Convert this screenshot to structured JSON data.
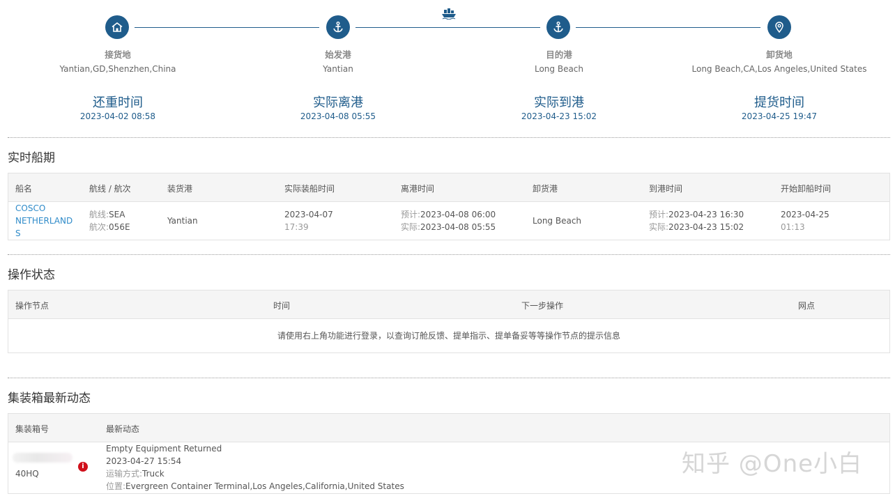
{
  "route": {
    "stops": [
      {
        "name": "接货地",
        "place": "Yantian,GD,Shenzhen,China",
        "event": "还重时间",
        "time": "2023-04-02 08:58",
        "icon": "home-icon"
      },
      {
        "name": "始发港",
        "place": "Yantian",
        "event": "实际离港",
        "time": "2023-04-08 05:55",
        "icon": "anchor-icon"
      },
      {
        "name": "目的港",
        "place": "Long Beach",
        "event": "实际到港",
        "time": "2023-04-23 15:02",
        "icon": "anchor-icon"
      },
      {
        "name": "卸货地",
        "place": "Long Beach,CA,Los Angeles,United States",
        "event": "提货时间",
        "time": "2023-04-25 19:47",
        "icon": "location-pin-icon"
      }
    ],
    "ship_icon": "ship-icon",
    "accent_color": "#1f5c8b"
  },
  "schedule": {
    "title": "实时船期",
    "headers": [
      "船名",
      "航线 / 航次",
      "装货港",
      "实际装船时间",
      "离港时间",
      "卸货港",
      "到港时间",
      "开始卸船时间"
    ],
    "row": {
      "vessel_line1": "COSCO",
      "vessel_line2": "NETHERLAND",
      "vessel_line3": "S",
      "route_label": "航线:",
      "route_value": "SEA",
      "voyage_label": "航次:",
      "voyage_value": "056E",
      "load_port": "Yantian",
      "loaded_date": "2023-04-07",
      "loaded_time": "17:39",
      "dep_est_label": "预计:",
      "dep_est": "2023-04-08 06:00",
      "dep_act_label": "实际:",
      "dep_act": "2023-04-08 05:55",
      "discharge_port": "Long Beach",
      "arr_est_label": "预计:",
      "arr_est": "2023-04-23 16:30",
      "arr_act_label": "实际:",
      "arr_act": "2023-04-23 15:02",
      "unload_date": "2023-04-25",
      "unload_time": "01:13"
    }
  },
  "operations": {
    "title": "操作状态",
    "headers": [
      "操作节点",
      "时间",
      "下一步操作",
      "网点"
    ],
    "notice": "请使用右上角功能进行登录，以查询订舱反馈、提单指示、提单备妥等等操作节点的提示信息"
  },
  "containers": {
    "title": "集装箱最新动态",
    "headers": [
      "集装箱号",
      "最新动态"
    ],
    "row": {
      "type": "40HQ",
      "badge": "i",
      "status": "Empty Equipment Returned",
      "time": "2023-04-27 15:54",
      "mode_label": "运输方式:",
      "mode": "Truck",
      "location_label": "位置:",
      "location": "Evergreen Container Terminal,Los Angeles,California,United States"
    }
  },
  "watermark": "知乎 @One小白"
}
